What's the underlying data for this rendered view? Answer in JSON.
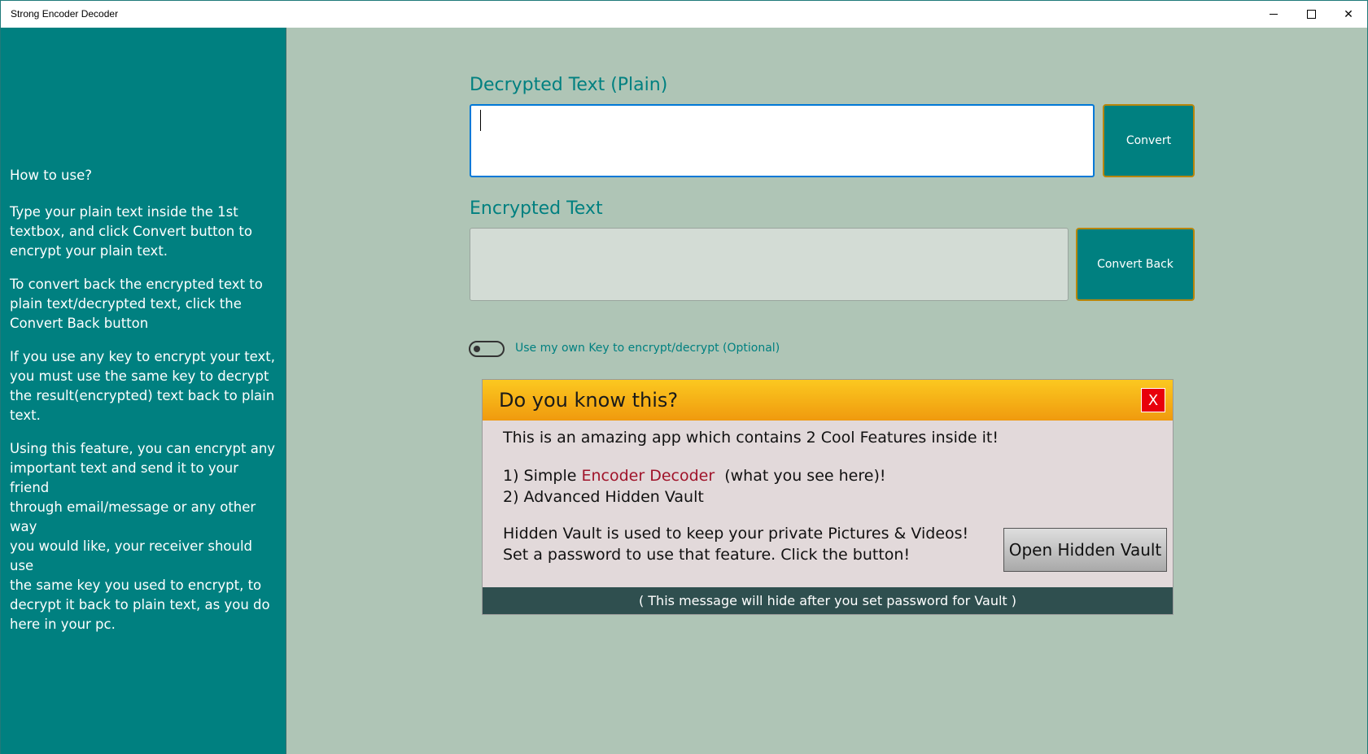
{
  "window": {
    "title": "Strong Encoder Decoder",
    "minimize_glyph": "",
    "maximize_glyph": "",
    "close_glyph": "✕"
  },
  "sidebar": {
    "paragraphs": [
      "How to use?",
      "Type your plain text inside the 1st\ntextbox, and click Convert button to\nencrypt your plain text.",
      "To convert back the encrypted text to\nplain text/decrypted text, click the\nConvert Back button",
      "If you use any key to encrypt your text,\nyou must use the same key to decrypt\nthe result(encrypted) text back to plain\ntext.",
      "Using this feature, you can encrypt any\nimportant text and send it to your friend\nthrough email/message or any other way\nyou would like, your receiver should use\nthe same key you used to encrypt, to\ndecrypt it back to plain text, as you do\nhere in your pc."
    ]
  },
  "main": {
    "decrypted_label": "Decrypted Text (Plain)",
    "decrypted_value": "",
    "convert_button": "Convert",
    "encrypted_label": "Encrypted Text",
    "encrypted_value": "",
    "convert_back_button": "Convert Back",
    "toggle_label": "Use my own Key to encrypt/decrypt (Optional)",
    "toggle_on": false
  },
  "info_panel": {
    "title": "Do you know this?",
    "close_label": "X",
    "intro": "This is an amazing app which contains 2 Cool Features inside it!",
    "feature1_prefix": "1) Simple ",
    "feature1_highlight": "Encoder Decoder",
    "feature1_suffix": "(what you see here)!",
    "feature2": "2) Advanced Hidden Vault",
    "vault_line1": "Hidden Vault is used to keep your private Pictures & Videos!",
    "vault_line2": "Set a password to use that feature. Click the button!",
    "vault_button": "Open Hidden Vault",
    "footer": "( This message will hide after you set password for Vault )"
  },
  "colors": {
    "sidebar_bg": "#008080",
    "main_bg": "#afc5b6",
    "accent": "#008080",
    "button_border": "#b8860b",
    "panel_header": "#f5b015",
    "panel_close": "#e8000b",
    "panel_footer": "#2f4f4f",
    "highlight_text": "#a0142a"
  }
}
